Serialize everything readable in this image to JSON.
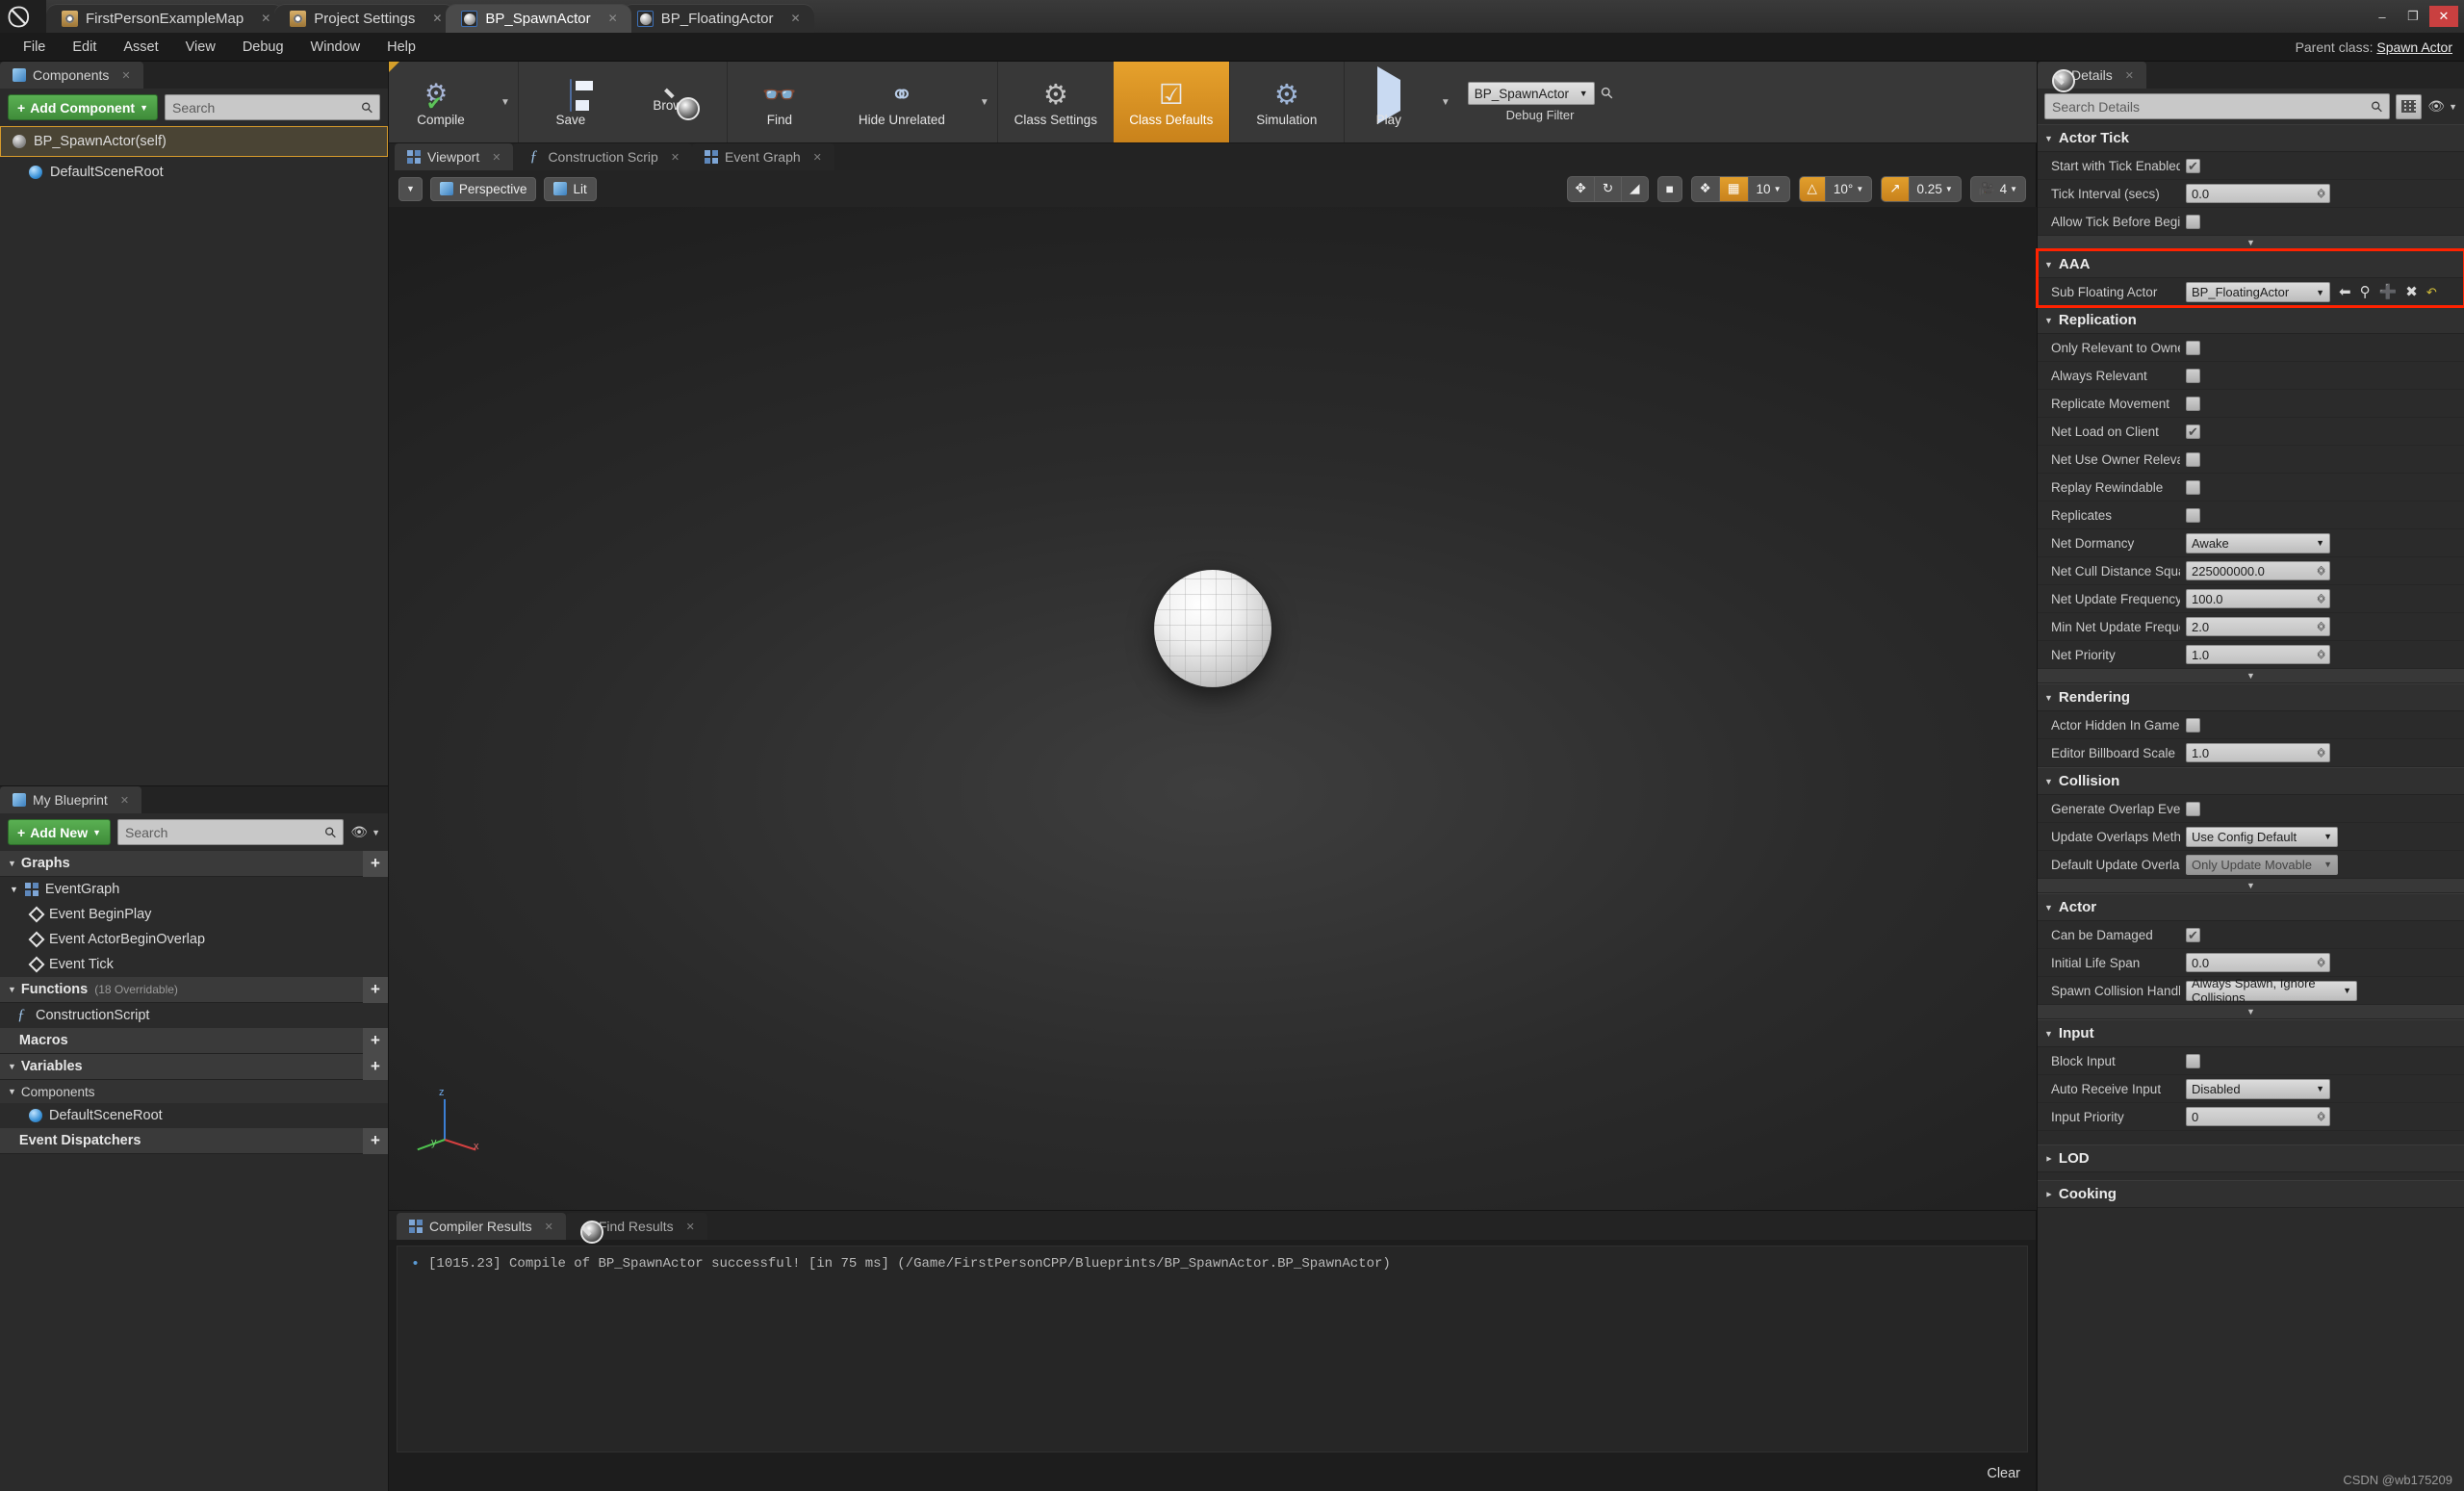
{
  "titlebar": {
    "logo": "ue-logo",
    "tabs": [
      {
        "label": "FirstPersonExampleMap",
        "icon": "map-icon",
        "active": false
      },
      {
        "label": "Project Settings",
        "icon": "folder-gear-icon",
        "active": false
      },
      {
        "label": "BP_SpawnActor",
        "icon": "blueprint-sphere-icon",
        "active": true
      },
      {
        "label": "BP_FloatingActor",
        "icon": "blueprint-sphere-icon",
        "active": false
      }
    ],
    "window_controls": {
      "minimize": "–",
      "maximize": "❐",
      "close": "✕"
    }
  },
  "menubar": {
    "items": [
      "File",
      "Edit",
      "Asset",
      "View",
      "Debug",
      "Window",
      "Help"
    ],
    "parent_class_label": "Parent class:",
    "parent_class_value": "Spawn Actor"
  },
  "components_panel": {
    "tab_label": "Components",
    "add_component_label": "Add Component",
    "search_placeholder": "Search",
    "tree": [
      {
        "label": "BP_SpawnActor(self)",
        "selected": true,
        "icon": "sphere-icon"
      },
      {
        "label": "DefaultSceneRoot",
        "selected": false,
        "icon": "scene-root-icon"
      }
    ]
  },
  "my_blueprint_panel": {
    "tab_label": "My Blueprint",
    "add_new_label": "Add New",
    "search_placeholder": "Search",
    "sections": [
      {
        "title": "Graphs",
        "count": "",
        "plus": "+"
      },
      {
        "title": "Functions",
        "count": "(18 Overridable)",
        "plus": "+"
      },
      {
        "title": "Macros",
        "count": "",
        "plus": "+"
      },
      {
        "title": "Variables",
        "count": "",
        "plus": "+"
      },
      {
        "title": "Event Dispatchers",
        "count": "",
        "plus": "+"
      }
    ],
    "event_graph": "EventGraph",
    "events": [
      "Event BeginPlay",
      "Event ActorBeginOverlap",
      "Event Tick"
    ],
    "functions": [
      "ConstructionScript"
    ],
    "variables_subgroup": "Components",
    "variables": [
      "DefaultSceneRoot"
    ]
  },
  "toolbar": {
    "buttons": [
      {
        "label": "Compile",
        "icon": "compile-gears-check-icon",
        "has_caret": true,
        "highlight": false
      },
      {
        "label": "Save",
        "icon": "floppy-disk-icon",
        "has_caret": false,
        "highlight": false
      },
      {
        "label": "Browse",
        "icon": "magnifier-icon",
        "has_caret": false,
        "highlight": false
      },
      {
        "label": "Find",
        "icon": "binoculars-icon",
        "has_caret": false,
        "highlight": false
      },
      {
        "label": "Hide Unrelated",
        "icon": "node-graph-icon",
        "has_caret": true,
        "highlight": false
      },
      {
        "label": "Class Settings",
        "icon": "gear-icon",
        "has_caret": false,
        "highlight": false
      },
      {
        "label": "Class Defaults",
        "icon": "checklist-icon",
        "has_caret": false,
        "highlight": true
      },
      {
        "label": "Simulation",
        "icon": "simulation-icon",
        "has_caret": false,
        "highlight": false
      },
      {
        "label": "Play",
        "icon": "play-triangle-icon",
        "has_caret": true,
        "highlight": false
      }
    ],
    "debug_filter_label": "Debug Filter",
    "debug_filter_value": "BP_SpawnActor"
  },
  "viewport": {
    "tabs": [
      {
        "label": "Viewport",
        "active": true,
        "icon": "viewport-grid-icon"
      },
      {
        "label": "Construction Scrip",
        "active": false,
        "icon": "function-icon"
      },
      {
        "label": "Event Graph",
        "active": false,
        "icon": "graph-icon"
      }
    ],
    "view_mode": "Perspective",
    "lighting_mode": "Lit",
    "snap_grid_value": "10",
    "snap_rotation_value": "10°",
    "snap_scale_value": "0.25",
    "camera_speed_value": "4"
  },
  "results_panel": {
    "tabs": [
      {
        "label": "Compiler Results",
        "active": true,
        "icon": "compiler-icon"
      },
      {
        "label": "Find Results",
        "active": false,
        "icon": "find-icon"
      }
    ],
    "log_line": "[1015.23] Compile of BP_SpawnActor successful! [in 75 ms] (/Game/FirstPersonCPP/Blueprints/BP_SpawnActor.BP_SpawnActor)",
    "clear_label": "Clear"
  },
  "details": {
    "tab_label": "Details",
    "search_placeholder": "Search Details",
    "categories": [
      {
        "name": "Actor Tick",
        "collapsed": false,
        "rows": [
          {
            "label": "Start with Tick Enabled",
            "type": "checkbox",
            "checked": true
          },
          {
            "label": "Tick Interval (secs)",
            "type": "number",
            "value": "0.0"
          },
          {
            "label": "Allow Tick Before Begi",
            "type": "checkbox",
            "checked": false
          }
        ],
        "expander": true
      },
      {
        "name": "AAA",
        "collapsed": false,
        "highlight_color": "#ff2200",
        "rows": [
          {
            "label": "Sub Floating Actor",
            "type": "object",
            "value": "BP_FloatingActor"
          }
        ],
        "expander": false
      },
      {
        "name": "Replication",
        "collapsed": false,
        "rows": [
          {
            "label": "Only Relevant to Owne",
            "type": "checkbox",
            "checked": false
          },
          {
            "label": "Always Relevant",
            "type": "checkbox",
            "checked": false
          },
          {
            "label": "Replicate Movement",
            "type": "checkbox",
            "checked": false
          },
          {
            "label": "Net Load on Client",
            "type": "checkbox",
            "checked": true
          },
          {
            "label": "Net Use Owner Releva",
            "type": "checkbox",
            "checked": false
          },
          {
            "label": "Replay Rewindable",
            "type": "checkbox",
            "checked": false
          },
          {
            "label": "Replicates",
            "type": "checkbox",
            "checked": false
          },
          {
            "label": "Net Dormancy",
            "type": "dropdown",
            "value": "Awake"
          },
          {
            "label": "Net Cull Distance Squa",
            "type": "number",
            "value": "225000000.0"
          },
          {
            "label": "Net Update Frequency",
            "type": "number",
            "value": "100.0"
          },
          {
            "label": "Min Net Update Freque",
            "type": "number",
            "value": "2.0"
          },
          {
            "label": "Net Priority",
            "type": "number",
            "value": "1.0"
          }
        ],
        "expander": true
      },
      {
        "name": "Rendering",
        "collapsed": false,
        "rows": [
          {
            "label": "Actor Hidden In Game",
            "type": "checkbox",
            "checked": false
          },
          {
            "label": "Editor Billboard Scale",
            "type": "number",
            "value": "1.0"
          }
        ],
        "expander": false
      },
      {
        "name": "Collision",
        "collapsed": false,
        "rows": [
          {
            "label": "Generate Overlap Even",
            "type": "checkbox",
            "checked": false
          },
          {
            "label": "Update Overlaps Meth",
            "type": "dropdown",
            "value": "Use Config Default"
          },
          {
            "label": "Default Update Overla",
            "type": "dropdown-dim",
            "value": "Only Update Movable"
          }
        ],
        "expander": true
      },
      {
        "name": "Actor",
        "collapsed": false,
        "rows": [
          {
            "label": "Can be Damaged",
            "type": "checkbox",
            "checked": true
          },
          {
            "label": "Initial Life Span",
            "type": "number",
            "value": "0.0"
          },
          {
            "label": "Spawn Collision Handl",
            "type": "dropdown",
            "value": "Always Spawn, Ignore Collisions"
          }
        ],
        "expander": true
      },
      {
        "name": "Input",
        "collapsed": false,
        "rows": [
          {
            "label": "Block Input",
            "type": "checkbox",
            "checked": false
          },
          {
            "label": "Auto Receive Input",
            "type": "dropdown",
            "value": "Disabled"
          },
          {
            "label": "Input Priority",
            "type": "number",
            "value": "0"
          }
        ],
        "expander": false
      },
      {
        "name": "LOD",
        "collapsed": true,
        "rows": [],
        "expander": false
      },
      {
        "name": "Cooking",
        "collapsed": true,
        "rows": [],
        "expander": false
      }
    ]
  },
  "watermark": "CSDN @wb175209"
}
